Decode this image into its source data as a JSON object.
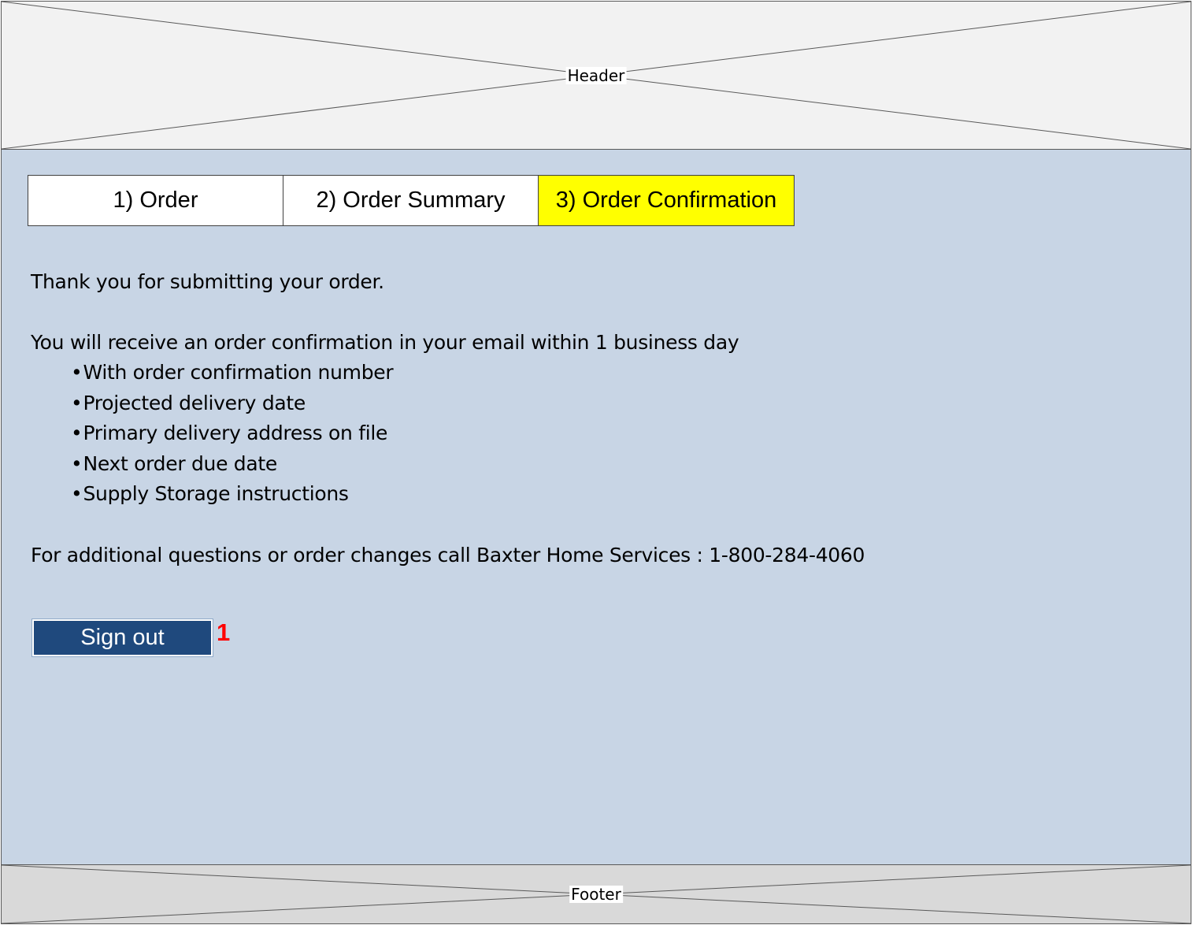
{
  "header": {
    "label": "Header"
  },
  "steps": [
    {
      "label": "1) Order"
    },
    {
      "label": "2) Order Summary"
    },
    {
      "label": "3) Order Confirmation",
      "active": true
    }
  ],
  "message": {
    "thanks": "Thank you for submitting your order.",
    "receive": "You will receive an order confirmation in your email within 1  business day",
    "bullet_char": "•",
    "bullets": [
      "With order confirmation number",
      "Projected delivery date",
      "Primary delivery address on file",
      "Next order due date",
      "Supply Storage instructions"
    ],
    "contact": "For additional questions or order changes call Baxter Home Services : 1-800-284-4060"
  },
  "signout": {
    "label": "Sign out",
    "annotation": "1"
  },
  "footer": {
    "label": "Footer"
  },
  "colors": {
    "header_bg": "#f2f2f2",
    "main_bg": "#c8d5e5",
    "active_step": "#ffff00",
    "button_bg": "#1f497d",
    "annotation": "#ff0000",
    "footer_bg": "#d9d9d9"
  }
}
